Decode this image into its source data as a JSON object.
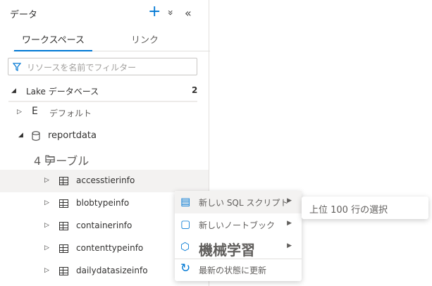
{
  "header": {
    "title": "データ",
    "add": "+",
    "expand": "»",
    "collapse": "«"
  },
  "tabs": [
    {
      "label": "ワークスペース",
      "active": true
    },
    {
      "label": "リンク",
      "active": false
    }
  ],
  "filter": {
    "placeholder": "リソースを名前でフィルター"
  },
  "section": {
    "label": "Lake データベース",
    "count": "2"
  },
  "tree": {
    "default": "デフォルト",
    "reportdata": "reportdata",
    "tables_label": "4 テーブル",
    "tables": [
      "accesstierinfo",
      "blobtypeinfo",
      "containerinfo",
      "contenttypeinfo",
      "dailydatasizeinfo"
    ]
  },
  "context_menu": [
    {
      "label": "新しい SQL スクリプト",
      "icon": "sql-script-icon"
    },
    {
      "label": "新しいノートブック",
      "icon": "notebook-icon"
    },
    {
      "label": "機械学習",
      "icon": "machine-learning-icon"
    },
    {
      "label": "最新の状態に更新",
      "icon": "refresh-icon"
    }
  ],
  "submenu": {
    "label": "上位 100 行の選択"
  },
  "colors": {
    "accent": "#0078d4"
  }
}
